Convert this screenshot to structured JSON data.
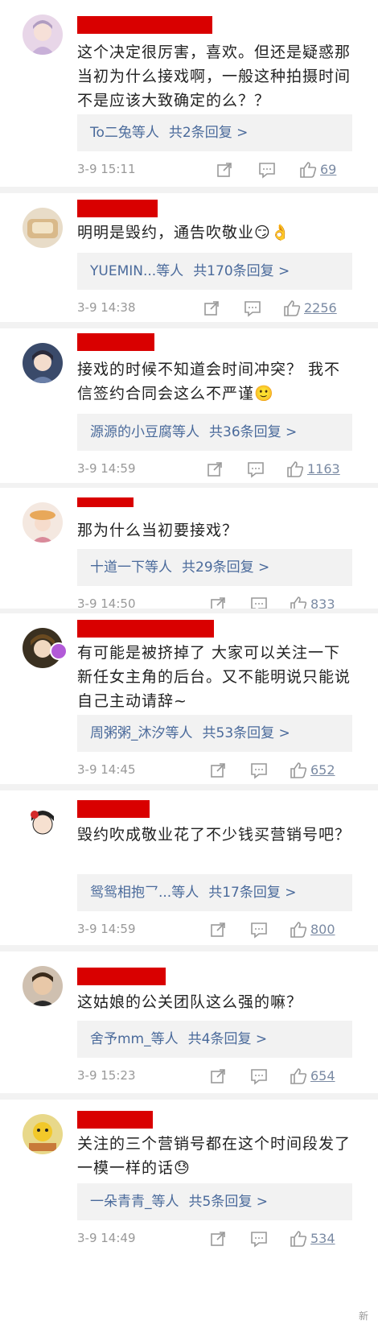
{
  "comments": [
    {
      "text": "这个决定很厉害，喜欢。但还是疑惑那当初为什么接戏啊，一般这种拍摄时间不是应该大致确定的么？？",
      "reply_users": "To二兔等人",
      "reply_count": "共2条回复 >",
      "time": "3-9 15:11",
      "likes": "69",
      "emoji": ""
    },
    {
      "text": "明明是毁约，通告吹敬业",
      "reply_users": "YUEMIN...等人",
      "reply_count": "共170条回复 >",
      "time": "3-9 14:38",
      "likes": "2256",
      "emoji": "😏👌"
    },
    {
      "text": "接戏的时候不知道会时间冲突？ 我不信签约合同会这么不严谨",
      "reply_users": "源源的小豆腐等人",
      "reply_count": "共36条回复 >",
      "time": "3-9 14:59",
      "likes": "1163",
      "emoji": "🙂"
    },
    {
      "text": "那为什么当初要接戏？",
      "reply_users": "十道一下等人",
      "reply_count": "共29条回复 >",
      "time": "3-9 14:50",
      "likes": "833",
      "emoji": ""
    },
    {
      "text": "有可能是被挤掉了 大家可以关注一下新任女主角的后台。又不能明说只能说自己主动请辞~",
      "reply_users": "周粥粥_沐汐等人",
      "reply_count": "共53条回复 >",
      "time": "3-9 14:45",
      "likes": "652",
      "emoji": ""
    },
    {
      "text": "毁约吹成敬业花了不少钱买营销号吧？",
      "reply_users": "鸳鸳相抱乛...等人",
      "reply_count": "共17条回复 >",
      "time": "3-9 14:59",
      "likes": "800",
      "emoji": ""
    },
    {
      "text": "这姑娘的公关团队这么强的嘛？",
      "reply_users": "舍予mm_等人",
      "reply_count": "共4条回复 >",
      "time": "3-9 15:23",
      "likes": "654",
      "emoji": ""
    },
    {
      "text": "关注的三个营销号都在这个时间段发了一模一样的话",
      "reply_users": "一朵青青_等人",
      "reply_count": "共5条回复 >",
      "time": "3-9 14:49",
      "likes": "534",
      "emoji": "😓"
    }
  ],
  "watermark": "新",
  "colors": {
    "name_redaction": "#d90000",
    "link": "#4a6a9b",
    "background": "#f2f2f2"
  }
}
